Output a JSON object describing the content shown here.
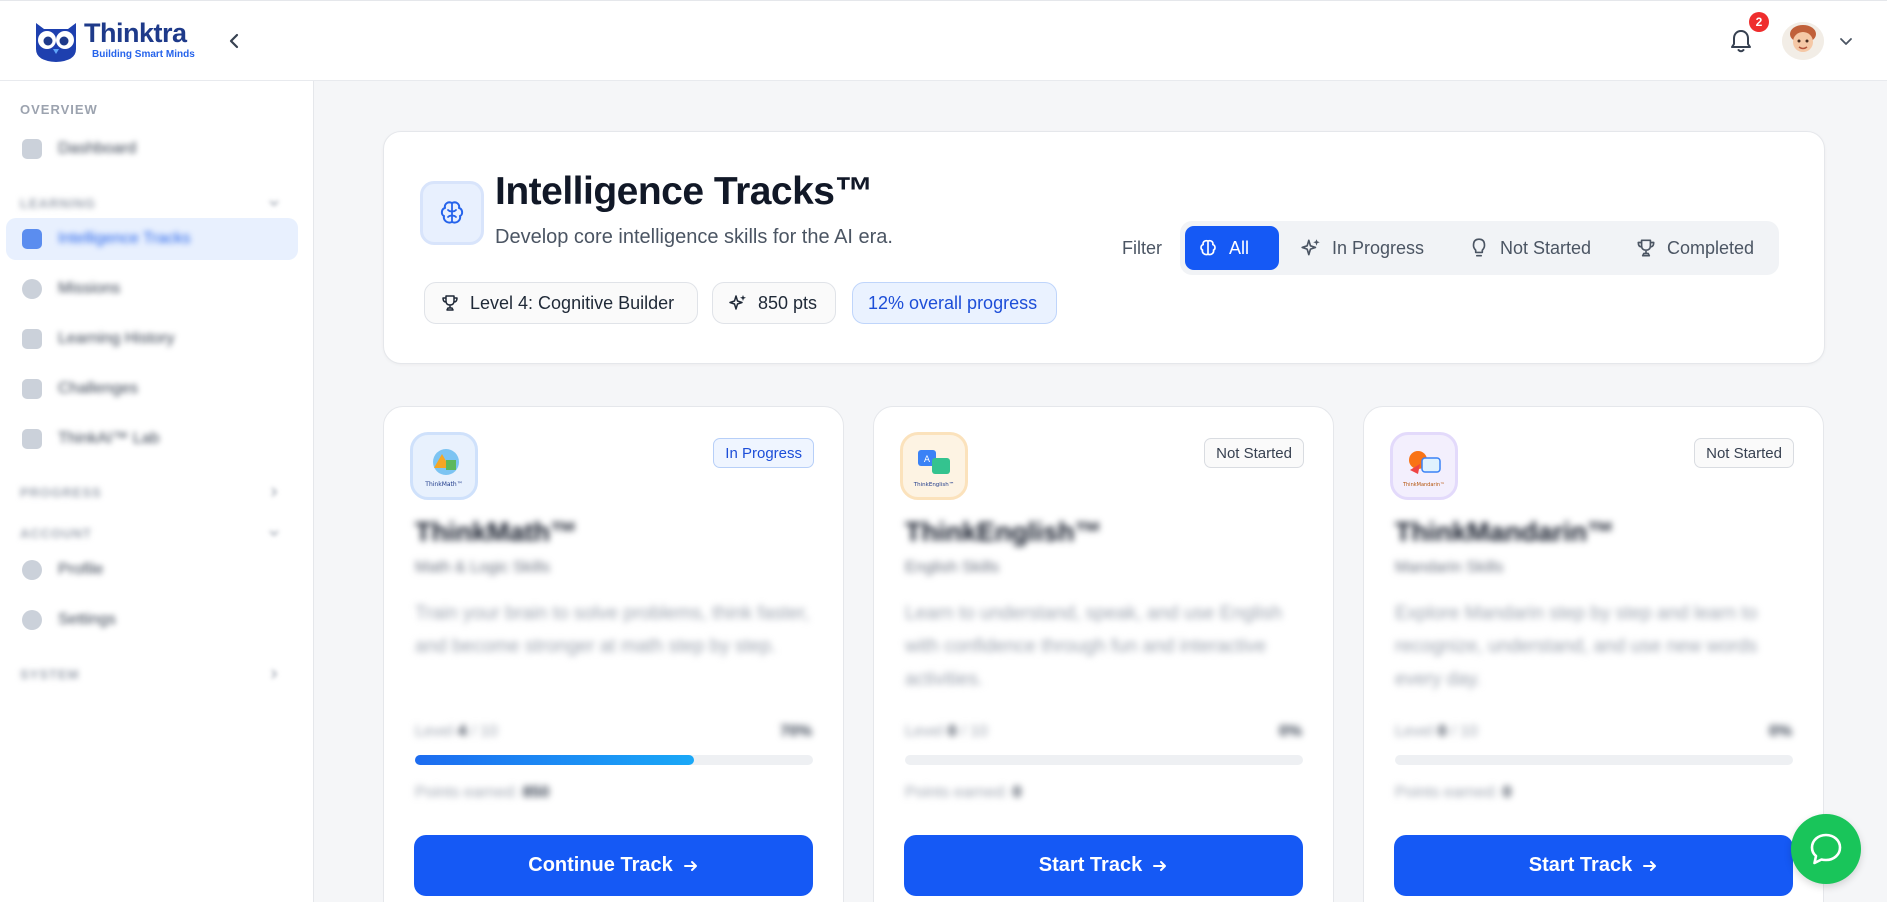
{
  "app": {
    "name": "Thinktra",
    "tagline": "Building Smart Minds"
  },
  "header": {
    "notification_count": "2"
  },
  "sidebar": {
    "sections": {
      "overview": "OVERVIEW",
      "learning": "LEARNING",
      "progress": "PROGRESS",
      "account": "ACCOUNT",
      "system": "SYSTEM"
    },
    "items": [
      {
        "label": "Dashboard"
      },
      {
        "label": "Intelligence Tracks"
      },
      {
        "label": "Missions"
      },
      {
        "label": "Learning History"
      },
      {
        "label": "Challenges"
      },
      {
        "label": "ThinkAI™ Lab"
      },
      {
        "label": "Profile"
      },
      {
        "label": "Settings"
      }
    ]
  },
  "hero": {
    "title": "Intelligence Tracks™",
    "subtitle": "Develop core intelligence skills for the AI era.",
    "level": "Level 4: Cognitive Builder",
    "points": "850 pts",
    "overall_progress": "12% overall progress",
    "filter_label": "Filter",
    "filters": [
      "All",
      "In Progress",
      "Not Started",
      "Completed"
    ],
    "active_filter": "All"
  },
  "tracks": [
    {
      "name": "ThinkMath™",
      "category": "Math & Logic Skills",
      "description": "Train your brain to solve problems, think faster, and become stronger at math step by step.",
      "status": "In Progress",
      "level_label": "Level",
      "level": "4",
      "level_max": "/ 10",
      "percent": "70%",
      "progress": 0.7,
      "points_label": "Points earned:",
      "points": "850",
      "button": "Continue Track",
      "logo_caption": "ThinkMath™",
      "accent": "#3b82f6"
    },
    {
      "name": "ThinkEnglish™",
      "category": "English Skills",
      "description": "Learn to understand, speak, and use English with confidence through fun and interactive activities.",
      "status": "Not Started",
      "level_label": "Level",
      "level": "0",
      "level_max": "/ 10",
      "percent": "0%",
      "progress": 0,
      "points_label": "Points earned:",
      "points": "0",
      "button": "Start Track",
      "logo_caption": "ThinkEnglish™",
      "accent": "#f59e0b"
    },
    {
      "name": "ThinkMandarin™",
      "category": "Mandarin Skills",
      "description": "Explore Mandarin step by step and learn to recognize, understand, and use new words every day.",
      "status": "Not Started",
      "level_label": "Level",
      "level": "0",
      "level_max": "/ 10",
      "percent": "0%",
      "progress": 0,
      "points_label": "Points earned:",
      "points": "0",
      "button": "Start Track",
      "logo_caption": "ThinkMandarin™",
      "accent": "#a78bfa"
    }
  ],
  "colors": {
    "primary": "#1559f5",
    "badge": "#ef2d2d",
    "chat": "#19c55a"
  }
}
